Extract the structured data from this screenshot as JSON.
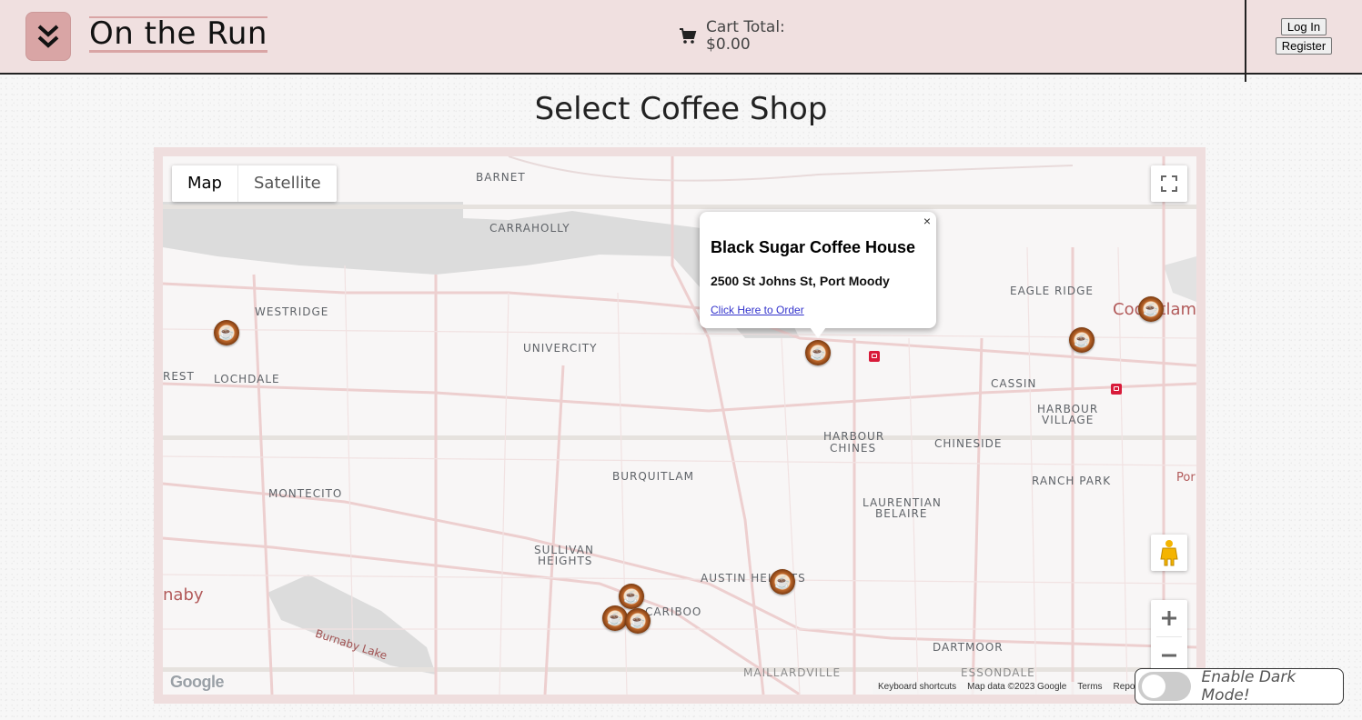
{
  "header": {
    "brand": "On the Run",
    "cart_label": "Cart Total:",
    "cart_total": "$0.00",
    "login_label": "Log In",
    "register_label": "Register"
  },
  "page": {
    "title": "Select Coffee Shop"
  },
  "map": {
    "type_map": "Map",
    "type_satellite": "Satellite",
    "places": [
      "BARNET",
      "CARRAHOLLY",
      "WESTRIDGE",
      "UNIVERCITY",
      "EAGLE RIDGE",
      "REST",
      "LOCHDALE",
      "CASSIN",
      "HARBOUR",
      "VILLAGE",
      "HARBOUR",
      "CHINES",
      "CHINESIDE",
      "BURQUITLAM",
      "RANCH PARK",
      "MONTECITO",
      "LAURENTIAN",
      "BELAIRE",
      "SULLIVAN",
      "HEIGHTS",
      "AUSTIN HEIGHTS",
      "CARIBOO",
      "DARTMOOR",
      "MAILLARDVILLE",
      "ESSONDALE"
    ],
    "cities": [
      "Coquitlam",
      "naby",
      "Por"
    ],
    "lake": "Burnaby Lake",
    "infowindow": {
      "title": "Black Sugar Coffee House",
      "address": "2500 St Johns St, Port Moody",
      "link": "Click Here to Order",
      "close": "×"
    },
    "logo": "Google",
    "attribution": [
      "Keyboard shortcuts",
      "Map data ©2023 Google",
      "Terms",
      "Report a map error"
    ]
  },
  "dark_mode": {
    "label": "Enable Dark Mode!"
  }
}
